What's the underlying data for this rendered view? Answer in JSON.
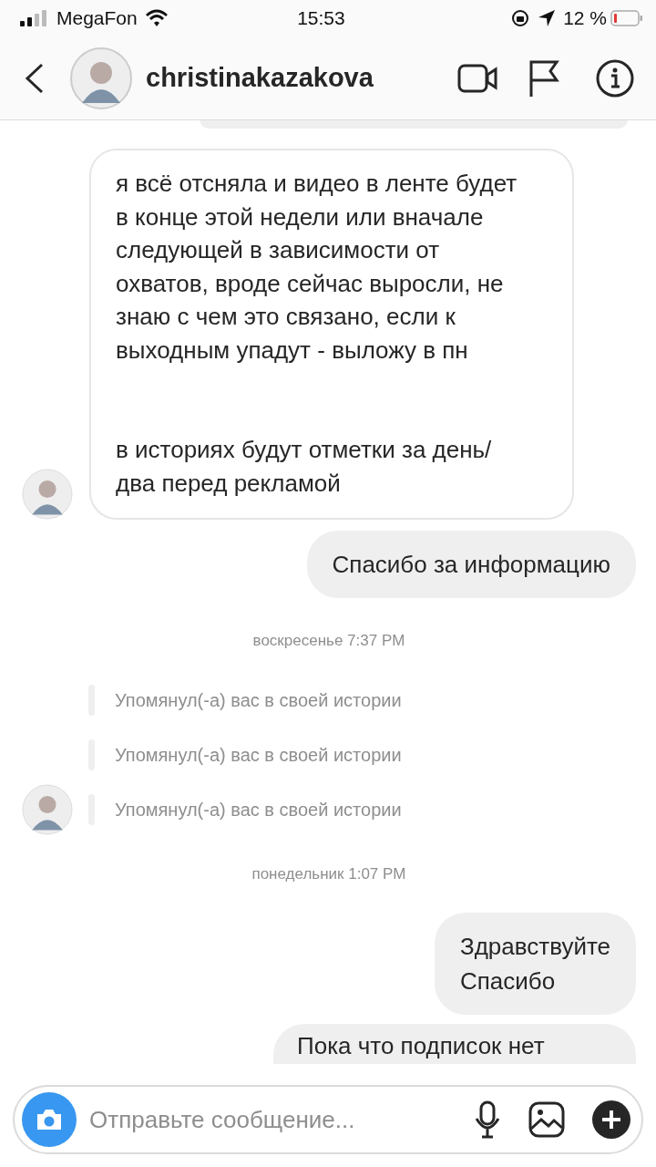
{
  "status_bar": {
    "carrier": "MegaFon",
    "time": "15:53",
    "battery": "12 %"
  },
  "header": {
    "username": "christinakazakova"
  },
  "messages": [
    {
      "kind": "incoming",
      "show_avatar": true,
      "paragraphs": [
        "я всё отсняла и видео в ленте будет в конце этой недели или вначале следующей в зависимости от охватов, вроде сейчас выросли, не знаю с чем это связано, если к выходным упадут - выложу в пн",
        "в историях будут отметки за день/ два перед рекламой"
      ]
    },
    {
      "kind": "outgoing",
      "paragraphs": [
        "Спасибо за информацию"
      ]
    },
    {
      "kind": "timestamp",
      "text": "воскресенье 7:37 PM"
    },
    {
      "kind": "mention",
      "show_avatar": false,
      "text": "Упомянул(-а) вас в своей истории"
    },
    {
      "kind": "mention",
      "show_avatar": false,
      "text": "Упомянул(-а) вас в своей истории"
    },
    {
      "kind": "mention",
      "show_avatar": true,
      "text": "Упомянул(-а) вас в своей истории"
    },
    {
      "kind": "timestamp",
      "text": "понедельник 1:07 PM"
    },
    {
      "kind": "outgoing",
      "paragraphs": [
        "Здравствуйте\nСпасибо"
      ]
    },
    {
      "kind": "outgoing_cut",
      "paragraphs": [
        "Пока что подписок нет"
      ]
    }
  ],
  "composer": {
    "placeholder": "Отправьте сообщение..."
  }
}
